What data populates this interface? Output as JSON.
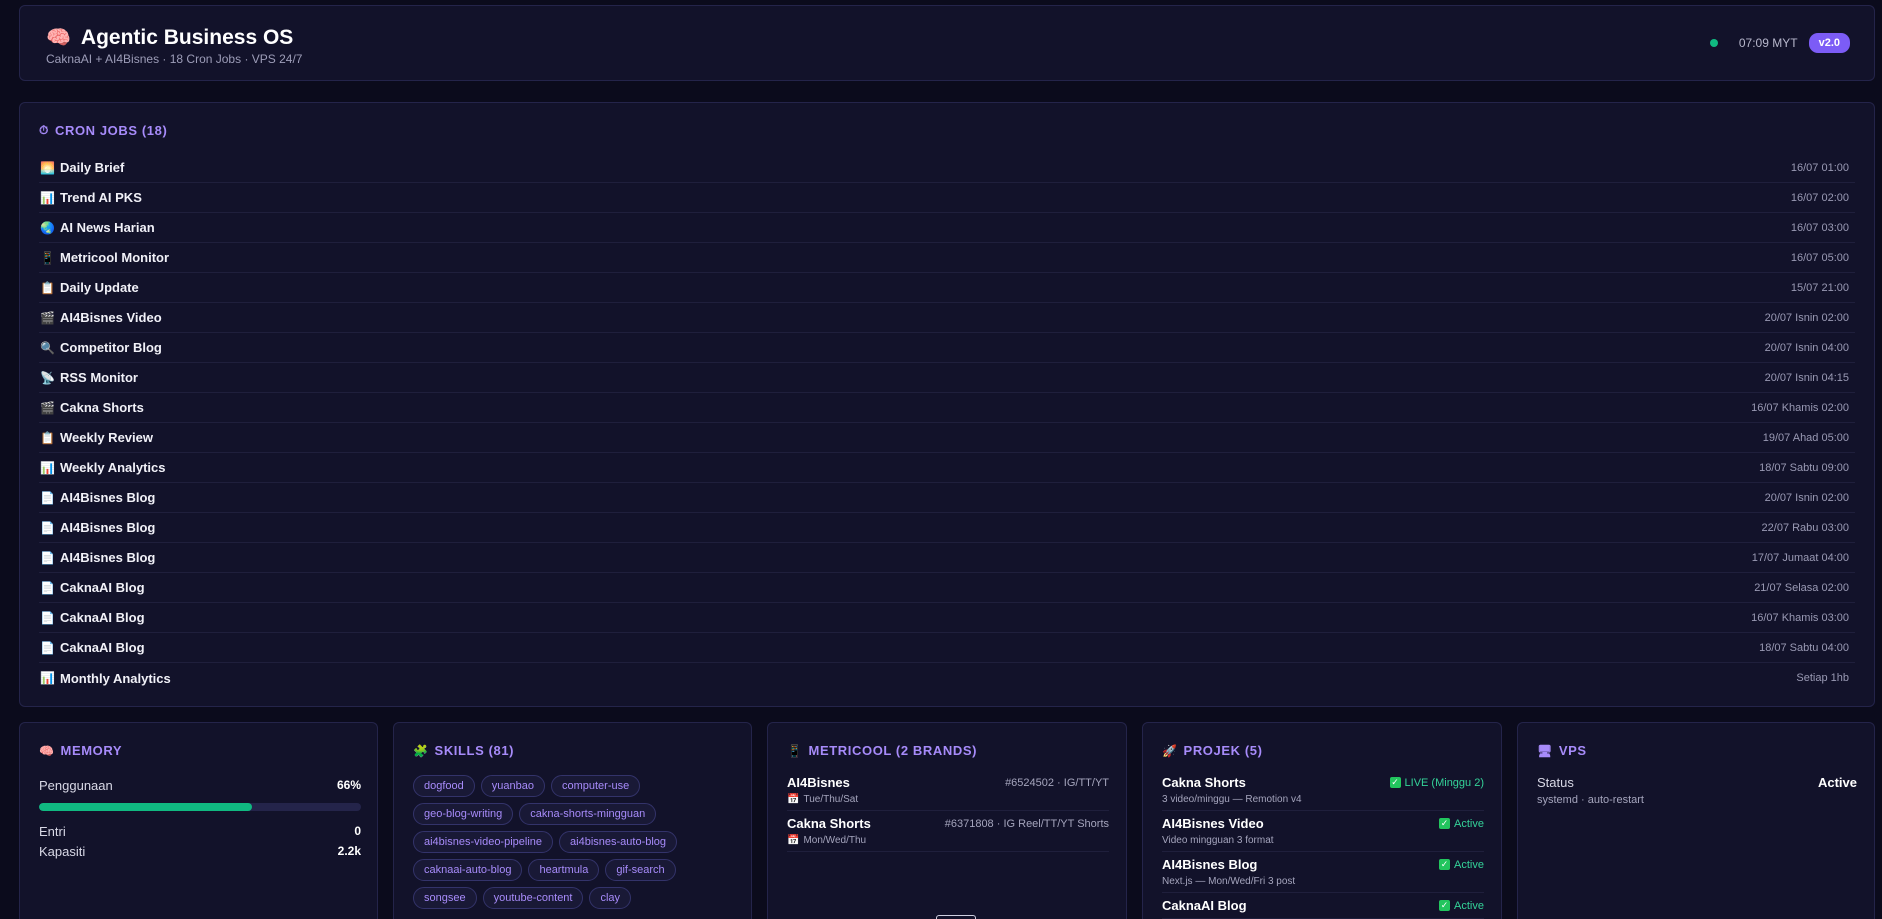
{
  "header": {
    "emoji": "🧠",
    "title": "Agentic Business OS",
    "subtitle": "CaknaAI + AI4Bisnes · 18 Cron Jobs · VPS 24/7",
    "time": "07:09 MYT",
    "version": "v2.0",
    "status_color": "#10b981"
  },
  "cron": {
    "icon": "⏱",
    "title": "CRON JOBS (18)",
    "jobs": [
      {
        "icon": "🌅",
        "name": "Daily Brief",
        "time": "16/07 01:00"
      },
      {
        "icon": "📊",
        "name": "Trend AI PKS",
        "time": "16/07 02:00"
      },
      {
        "icon": "🌏",
        "name": "AI News Harian",
        "time": "16/07 03:00"
      },
      {
        "icon": "📱",
        "name": "Metricool Monitor",
        "time": "16/07 05:00"
      },
      {
        "icon": "📋",
        "name": "Daily Update",
        "time": "15/07 21:00"
      },
      {
        "icon": "🎬",
        "name": "AI4Bisnes Video",
        "time": "20/07 Isnin 02:00"
      },
      {
        "icon": "🔍",
        "name": "Competitor Blog",
        "time": "20/07 Isnin 04:00"
      },
      {
        "icon": "📡",
        "name": "RSS Monitor",
        "time": "20/07 Isnin 04:15"
      },
      {
        "icon": "🎬",
        "name": "Cakna Shorts",
        "time": "16/07 Khamis 02:00"
      },
      {
        "icon": "📋",
        "name": "Weekly Review",
        "time": "19/07 Ahad 05:00"
      },
      {
        "icon": "📊",
        "name": "Weekly Analytics",
        "time": "18/07 Sabtu 09:00"
      },
      {
        "icon": "📄",
        "name": "AI4Bisnes Blog",
        "time": "20/07 Isnin 02:00"
      },
      {
        "icon": "📄",
        "name": "AI4Bisnes Blog",
        "time": "22/07 Rabu 03:00"
      },
      {
        "icon": "📄",
        "name": "AI4Bisnes Blog",
        "time": "17/07 Jumaat 04:00"
      },
      {
        "icon": "📄",
        "name": "CaknaAI Blog",
        "time": "21/07 Selasa 02:00"
      },
      {
        "icon": "📄",
        "name": "CaknaAI Blog",
        "time": "16/07 Khamis 03:00"
      },
      {
        "icon": "📄",
        "name": "CaknaAI Blog",
        "time": "18/07 Sabtu 04:00"
      },
      {
        "icon": "📊",
        "name": "Monthly Analytics",
        "time": "Setiap 1hb"
      }
    ]
  },
  "memory": {
    "icon": "🧠",
    "title": "MEMORY",
    "usage_label": "Penggunaan",
    "usage_value": "66%",
    "usage_fraction": 0.66,
    "entries_label": "Entri",
    "entries_value": "0",
    "capacity_label": "Kapasiti",
    "capacity_value": "2.2k"
  },
  "skills": {
    "icon": "🧩",
    "title": "SKILLS (81)",
    "tags": [
      "dogfood",
      "yuanbao",
      "computer-use",
      "geo-blog-writing",
      "cakna-shorts-mingguan",
      "ai4bisnes-video-pipeline",
      "ai4bisnes-auto-blog",
      "caknaai-auto-blog",
      "heartmula",
      "gif-search",
      "songsee",
      "youtube-content",
      "clay"
    ]
  },
  "metricool": {
    "icon": "📱",
    "title": "METRICOOL (2 BRANDS)",
    "brands": [
      {
        "name": "AI4Bisnes",
        "id": "#6524502 · IG/TT/YT",
        "schedule": "Tue/Thu/Sat"
      },
      {
        "name": "Cakna Shorts",
        "id": "#6371808 · IG Reel/TT/YT Shorts",
        "schedule": "Mon/Wed/Thu"
      }
    ]
  },
  "projek": {
    "icon": "🚀",
    "title": "PROJEK (5)",
    "items": [
      {
        "name": "Cakna Shorts",
        "status": "LIVE (Minggu 2)",
        "desc": "3 video/minggu — Remotion v4"
      },
      {
        "name": "AI4Bisnes Video",
        "status": "Active",
        "desc": "Video mingguan 3 format"
      },
      {
        "name": "AI4Bisnes Blog",
        "status": "Active",
        "desc": "Next.js — Mon/Wed/Fri 3 post"
      },
      {
        "name": "CaknaAI Blog",
        "status": "Active",
        "desc": ""
      }
    ]
  },
  "vps": {
    "icon": "🖥",
    "title": "VPS",
    "status_label": "Status",
    "status_value": "Active",
    "sub": "systemd · auto-restart"
  }
}
